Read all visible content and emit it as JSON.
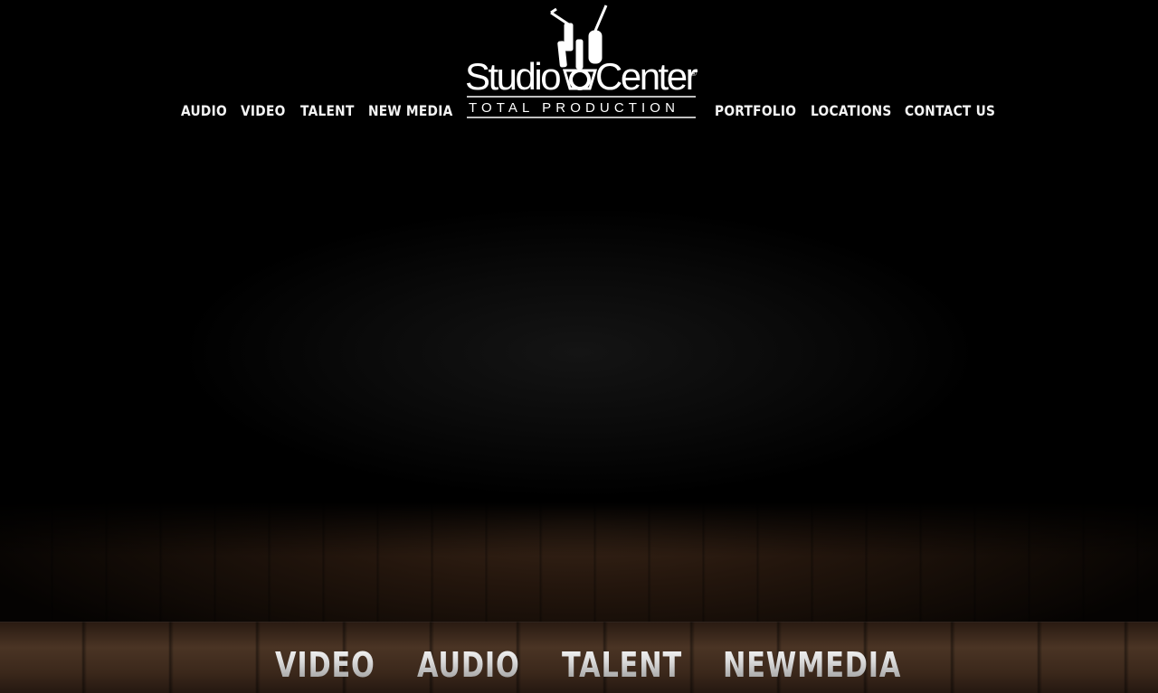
{
  "header": {
    "logo": {
      "brand_text": "StudioCenter",
      "tagline": "TOTAL PRODUCTION",
      "registered_mark": "®"
    },
    "nav_left": [
      {
        "label": "AUDIO"
      },
      {
        "label": "VIDEO"
      },
      {
        "label": "TALENT"
      },
      {
        "label": "NEW MEDIA"
      }
    ],
    "nav_right": [
      {
        "label": "PORTFOLIO"
      },
      {
        "label": "LOCATIONS"
      },
      {
        "label": "CONTACT US"
      }
    ]
  },
  "stage_nav": [
    {
      "label": "VIDEO"
    },
    {
      "label": "AUDIO"
    },
    {
      "label": "TALENT"
    },
    {
      "label": "NEWMEDIA"
    }
  ],
  "colors": {
    "background": "#000000",
    "nav_text": "#f4f4f4",
    "floor_wood": "#3a2618",
    "bottom_text": "#d9d9d9"
  }
}
